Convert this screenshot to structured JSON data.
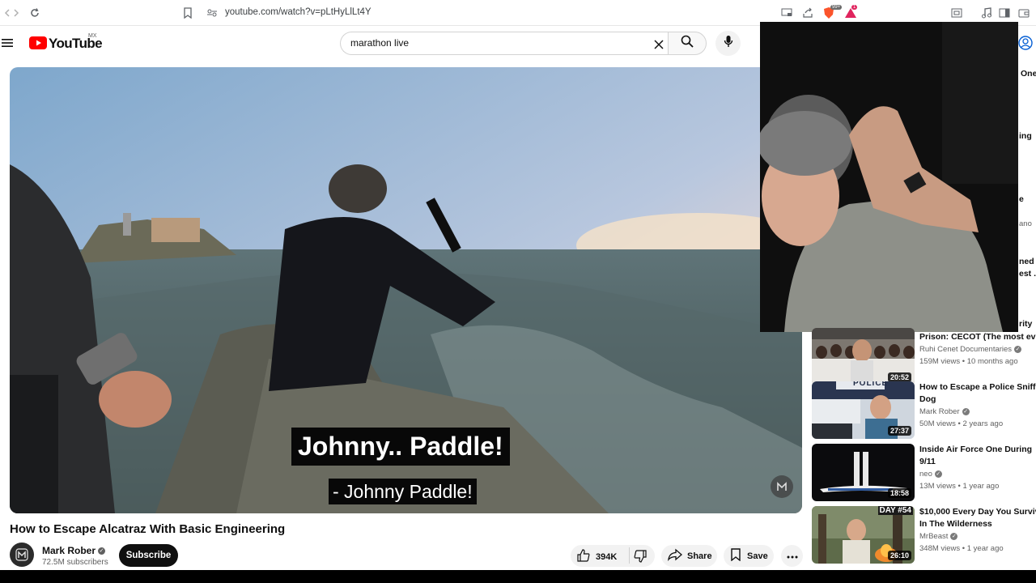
{
  "browser": {
    "url": "youtube.com/watch?v=pLtHyLlLt4Y",
    "shield_badge": "99+",
    "alert_badge": "1"
  },
  "header": {
    "logo": "YouTube",
    "region": "MX",
    "search_query": "marathon live"
  },
  "video": {
    "caption_line1": "Johnny.. Paddle!",
    "caption_line2": "- Johnny Paddle!",
    "title": "How to Escape Alcatraz With Basic Engineering",
    "channel": "Mark Rober",
    "subscribers": "72.5M subscribers",
    "subscribe_label": "Subscribe",
    "likes": "394K",
    "share_label": "Share",
    "save_label": "Save"
  },
  "partial_titles": [
    "One",
    "ing",
    "e",
    "ano",
    "ned",
    "est ...",
    "rity"
  ],
  "recommendations": [
    {
      "title1": "Prison: CECOT (The most evil ...",
      "title2": "",
      "channel": "Ruhi Cenet Documentaries",
      "meta": "159M views • 10 months ago",
      "duration": "20:52"
    },
    {
      "title1": "How to Escape a Police Sniffing",
      "title2": "Dog",
      "channel": "Mark Rober",
      "meta": "50M views • 2 years ago",
      "duration": "27:37"
    },
    {
      "title1": "Inside Air Force One During",
      "title2": "9/11",
      "channel": "neo",
      "meta": "13M views • 1 year ago",
      "duration": "18:58"
    },
    {
      "title1": "$10,000 Every Day You Survive",
      "title2": "In The Wilderness",
      "channel": "MrBeast",
      "meta": "348M views • 1 year ago",
      "duration": "26:10"
    }
  ],
  "thumb_labels": {
    "police": "POLICE",
    "day": "DAY #54"
  },
  "colors": {
    "yt_red": "#ff0000",
    "subscribe_bg": "#0f0f0f",
    "brave_orange": "#fb542b"
  }
}
